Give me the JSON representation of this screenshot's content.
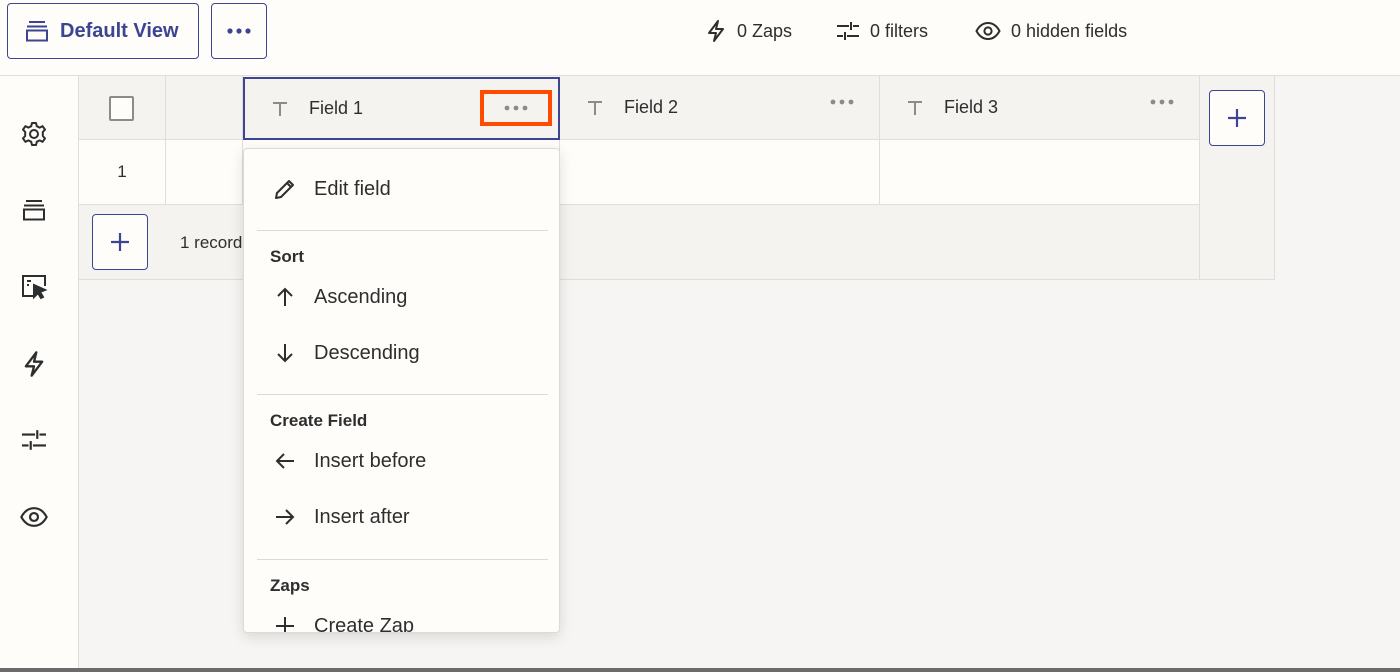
{
  "toolbar": {
    "view_label": "Default View",
    "zaps": "0 Zaps",
    "filters": "0 filters",
    "hidden": "0 hidden fields"
  },
  "grid": {
    "fields": [
      "Field 1",
      "Field 2",
      "Field 3"
    ],
    "rows": [
      {
        "num": "1"
      }
    ],
    "records": "1 record"
  },
  "menu": {
    "edit": "Edit field",
    "sort_heading": "Sort",
    "ascending": "Ascending",
    "descending": "Descending",
    "create_heading": "Create Field",
    "insert_before": "Insert before",
    "insert_after": "Insert after",
    "zaps_heading": "Zaps",
    "create_zap": "Create Zap"
  },
  "colors": {
    "accent": "#3d4592",
    "highlight": "#ff4a00",
    "background": "#f6f5f3",
    "surface": "#fffdf9"
  },
  "icons": [
    "views-icon",
    "more-icon",
    "zap-icon",
    "filter-icon",
    "eye-icon",
    "gear-icon",
    "interface-icon",
    "text-type-icon",
    "plus-icon",
    "pencil-icon",
    "arrow-up-icon",
    "arrow-down-icon",
    "arrow-left-icon",
    "arrow-right-icon"
  ]
}
